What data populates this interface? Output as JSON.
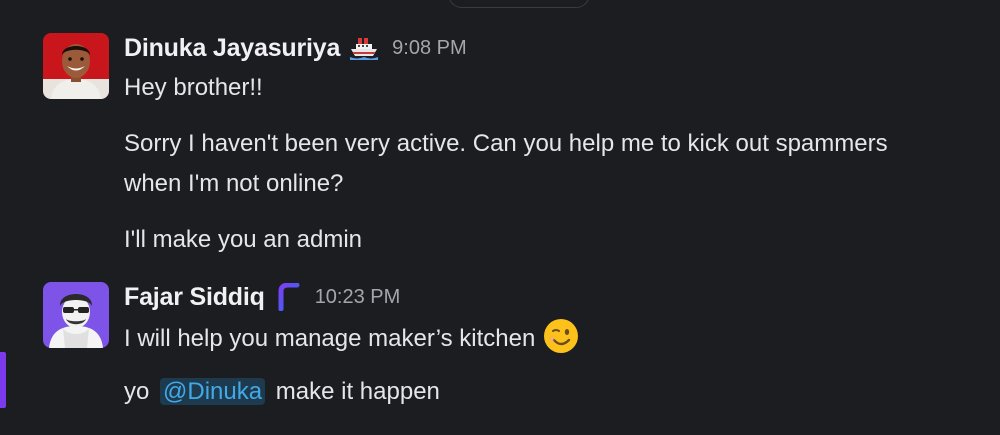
{
  "messages": [
    {
      "author": "Dinuka Jayasuriya",
      "badge_icon": "ship-icon",
      "timestamp": "9:08 PM",
      "lines": [
        "Hey brother!!",
        "Sorry I haven't been very active. Can you help me to kick out spammers",
        "when I'm not online?",
        "I'll make you an admin"
      ]
    },
    {
      "author": "Fajar Siddiq",
      "badge_icon": "letter-f-logo-icon",
      "timestamp": "10:23 PM",
      "lines": [
        "I will help you manage maker’s kitchen",
        "make it happen"
      ],
      "line2_prefix": "yo",
      "mention": "@Dinuka",
      "emoji": "winking-face-icon"
    }
  ],
  "colors": {
    "background": "#1c1d21",
    "mention_bg": "#1d3a4f",
    "mention_text": "#43a9e6",
    "accent": "#7c3aed"
  }
}
